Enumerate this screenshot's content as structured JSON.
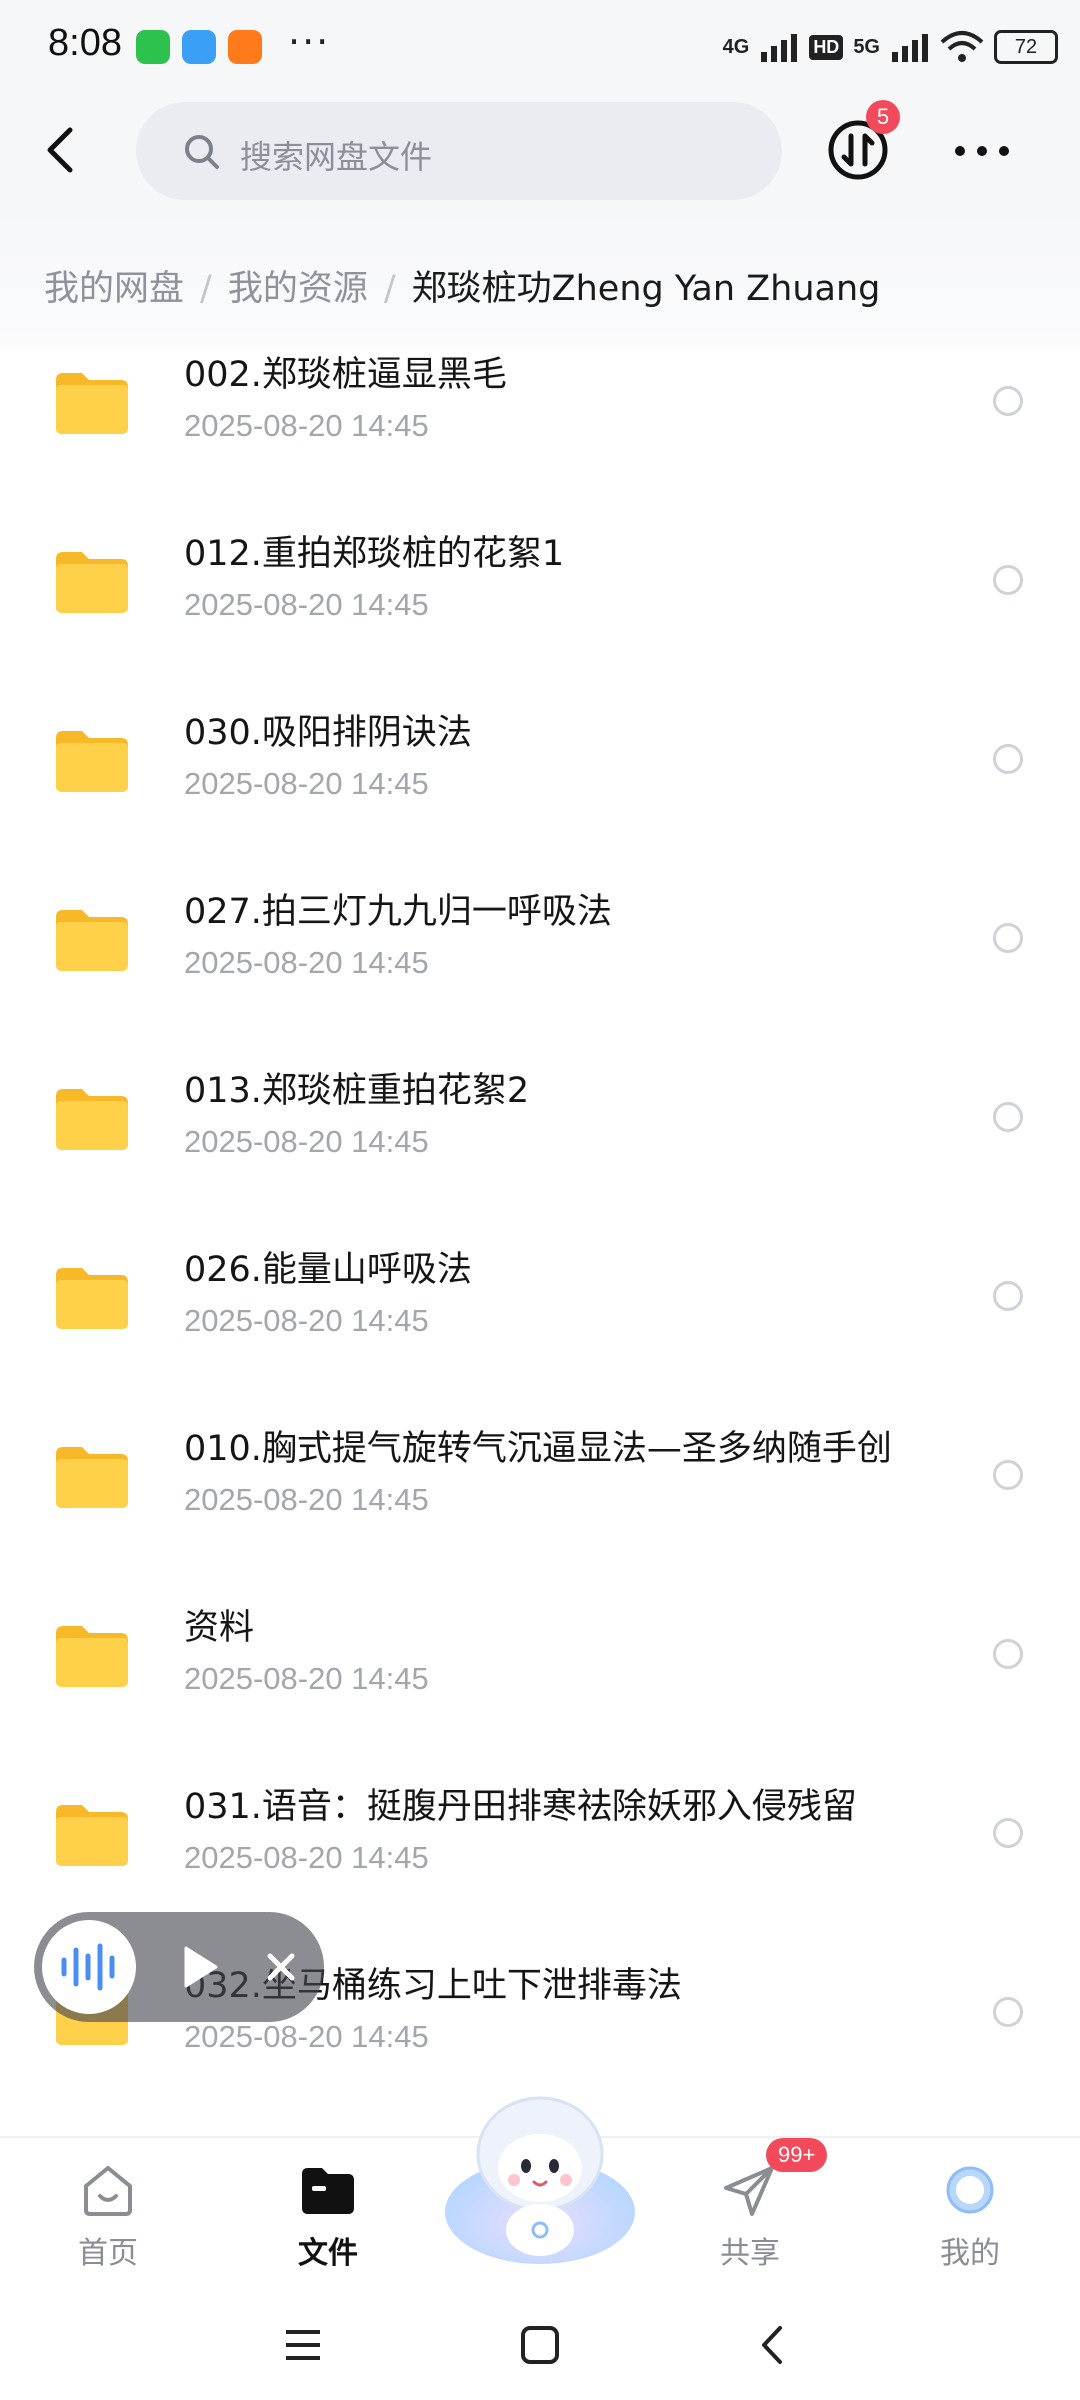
{
  "status_bar": {
    "time": "8:08",
    "signal_1": "4G",
    "hd": "HD",
    "signal_2": "5G",
    "battery": "72"
  },
  "header": {
    "search_placeholder": "搜索网盘文件",
    "transfer_badge": "5"
  },
  "breadcrumb": [
    {
      "label": "我的网盘"
    },
    {
      "label": "我的资源"
    },
    {
      "label": "郑琰桩功Zheng Yan Zhuang"
    }
  ],
  "files": [
    {
      "name": "002.郑琰桩逼显黑毛",
      "date": "2025-08-20  14:45"
    },
    {
      "name": "012.重拍郑琰桩的花絮1",
      "date": "2025-08-20  14:45"
    },
    {
      "name": "030.吸阳排阴诀法",
      "date": "2025-08-20  14:45"
    },
    {
      "name": "027.拍三灯九九归一呼吸法",
      "date": "2025-08-20  14:45"
    },
    {
      "name": "013.郑琰桩重拍花絮2",
      "date": "2025-08-20  14:45"
    },
    {
      "name": "026.能量山呼吸法",
      "date": "2025-08-20  14:45"
    },
    {
      "name": "010.胸式提气旋转气沉逼显法—圣多纳随手创",
      "date": "2025-08-20  14:45"
    },
    {
      "name": "资料",
      "date": "2025-08-20  14:45"
    },
    {
      "name": "031.语音：挺腹丹田排寒祛除妖邪入侵残留",
      "date": "2025-08-20  14:45"
    },
    {
      "name": "032.坐马桶练习上吐下泄排毒法",
      "date": "2025-08-20  14:45"
    }
  ],
  "bottom_nav": {
    "home": "首页",
    "files": "文件",
    "share": "共享",
    "share_badge": "99+",
    "mine": "我的"
  },
  "colors": {
    "folder": "#ffcc3d",
    "badge": "#f2495b",
    "accent_blue": "#4a8ff0"
  }
}
